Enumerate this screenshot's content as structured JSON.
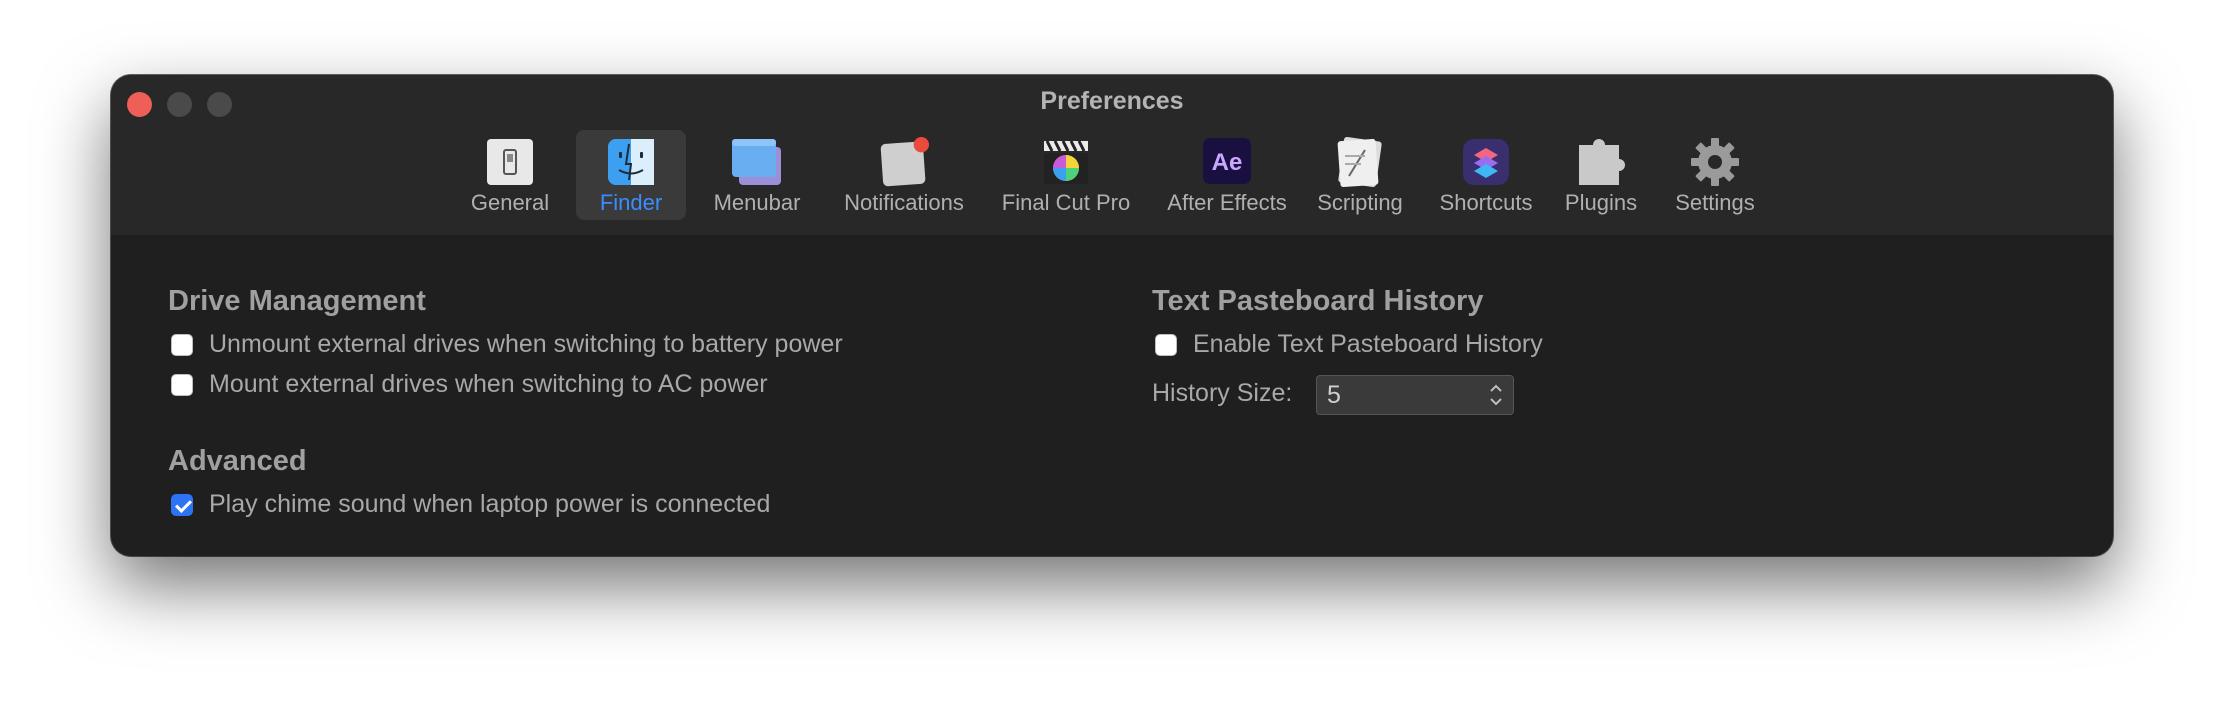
{
  "window": {
    "title": "Preferences"
  },
  "toolbar": {
    "items": [
      {
        "label": "General",
        "icon": "general-icon"
      },
      {
        "label": "Finder",
        "icon": "finder-icon",
        "selected": true
      },
      {
        "label": "Menubar",
        "icon": "menubar-icon"
      },
      {
        "label": "Notifications",
        "icon": "notifications-icon"
      },
      {
        "label": "Final Cut Pro",
        "icon": "final-cut-pro-icon"
      },
      {
        "label": "After Effects",
        "icon": "after-effects-icon",
        "icon_text": "Ae"
      },
      {
        "label": "Scripting",
        "icon": "scripting-icon"
      },
      {
        "label": "Shortcuts",
        "icon": "shortcuts-icon"
      },
      {
        "label": "Plugins",
        "icon": "plugins-icon"
      },
      {
        "label": "Settings",
        "icon": "gear-icon"
      }
    ]
  },
  "drive_management": {
    "title": "Drive Management",
    "options": [
      {
        "label": "Unmount external drives when switching to battery power",
        "checked": false
      },
      {
        "label": "Mount external drives when switching to AC power",
        "checked": false
      }
    ]
  },
  "advanced": {
    "title": "Advanced",
    "options": [
      {
        "label": "Play chime sound when laptop power is connected",
        "checked": true
      }
    ]
  },
  "pasteboard": {
    "title": "Text Pasteboard History",
    "enable_label": "Enable Text Pasteboard History",
    "enable_checked": false,
    "history_size_label": "History Size:",
    "history_size_value": "5"
  },
  "colors": {
    "accent": "#2d73f5",
    "selected_text": "#3b8cff",
    "window_bg": "#1f1f1f",
    "toolbar_bg": "#282828"
  }
}
